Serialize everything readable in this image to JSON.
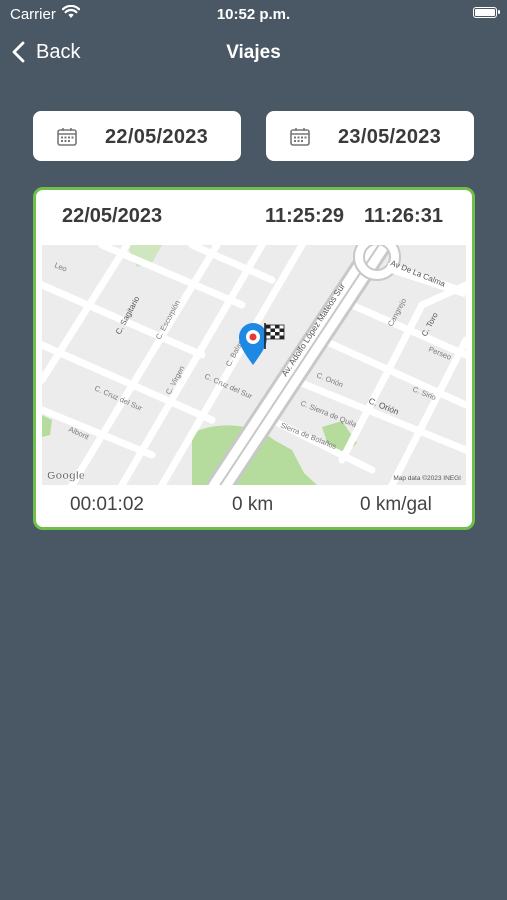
{
  "status_bar": {
    "carrier": "Carrier",
    "time": "10:52 p.m.",
    "icons": [
      "wifi-icon",
      "battery-icon"
    ]
  },
  "nav": {
    "back_label": "Back",
    "title": "Viajes",
    "back_icon": "chevron-left-icon"
  },
  "filters": {
    "date_from": "22/05/2023",
    "date_to": "23/05/2023",
    "icon": "calendar-icon"
  },
  "trip": {
    "date": "22/05/2023",
    "start_time": "11:25:29",
    "end_time": "11:26:31",
    "duration": "00:01:02",
    "distance": "0 km",
    "consumption": "0 km/gal",
    "border_color": "#6ec04a",
    "map": {
      "streets": [
        "Leo",
        "C. Sagitario",
        "C. Escorpión",
        "C. Virgen",
        "C. Cruz del Sur",
        "Alborit",
        "C. Balanza",
        "C. Cruz del Sur",
        "Av. Adolfo López Mateos Sur",
        "Av De La Calma",
        "Cangrejo",
        "C. Toro",
        "Perseo",
        "C. Orión",
        "C. Orión",
        "C. Sirio",
        "C. Sierra de Quila",
        "Sierra de Bolaños"
      ],
      "google_logo": "Google",
      "attribution": "Map data ©2023 INEGI",
      "start_marker_color": "#1e88e5",
      "end_marker": "checkered-flag-icon"
    }
  },
  "colors": {
    "background": "#4a5866",
    "card": "#ffffff",
    "accent": "#6ec04a"
  }
}
